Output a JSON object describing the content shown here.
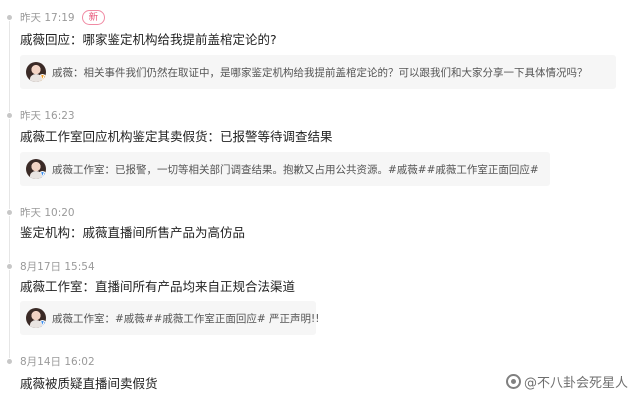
{
  "entries": [
    {
      "time": "昨天 17:19",
      "badge": "新",
      "title": "戚薇回应：哪家鉴定机构给我提前盖棺定论的?",
      "card": "戚薇：相关事件我们仍然在取证中，是哪家鉴定机构给我提前盖棺定论的？可以跟我们和大家分享一下具体情况吗？"
    },
    {
      "time": "昨天 16:23",
      "title": "戚薇工作室回应机构鉴定其卖假货：已报警等待调查结果",
      "card": "戚薇工作室：已报警，一切等相关部门调查结果。抱歉又占用公共资源。#戚薇##戚薇工作室正面回应#"
    },
    {
      "time": "昨天 10:20",
      "title": "鉴定机构：戚薇直播间所售产品为高仿品"
    },
    {
      "time": "8月17日 15:54",
      "title": "戚薇工作室：直播间所有产品均来自正规合法渠道",
      "card": "戚薇工作室：#戚薇##戚薇工作室正面回应# 严正声明!!"
    },
    {
      "time": "8月14日 16:02",
      "title": "戚薇被质疑直播间卖假货"
    }
  ],
  "watermark": "@不八卦会死星人",
  "colors": {
    "badge": "#e8577a",
    "dot": "#c7c7c7",
    "card_bg": "#f6f6f6"
  },
  "icons": {
    "verified_orange": "V",
    "verified_blue": "V"
  }
}
